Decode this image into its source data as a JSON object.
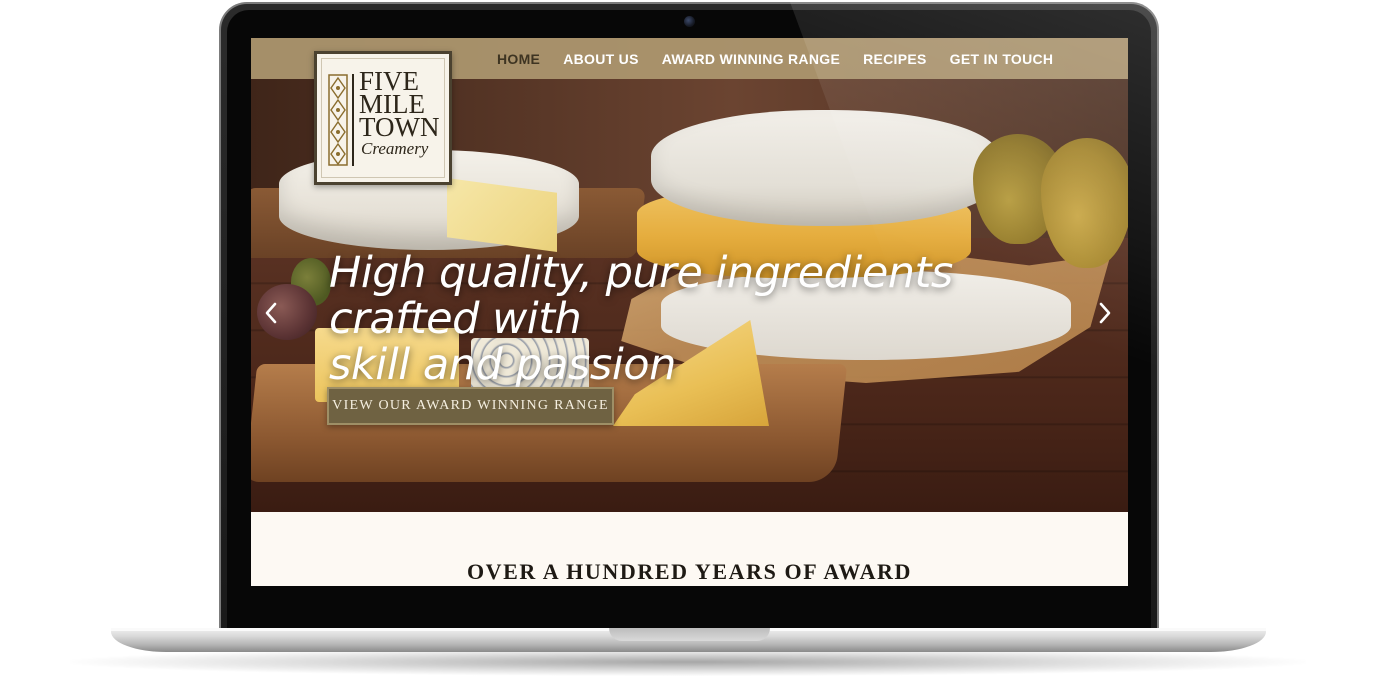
{
  "site": {
    "logo": {
      "lines": [
        "FIVE",
        "MILE",
        "TOWN"
      ],
      "sub": "Creamery"
    },
    "nav": {
      "items": [
        {
          "label": "HOME",
          "active": true
        },
        {
          "label": "ABOUT US",
          "active": false
        },
        {
          "label": "AWARD WINNING RANGE",
          "active": false
        },
        {
          "label": "RECIPES",
          "active": false
        },
        {
          "label": "GET IN TOUCH",
          "active": false
        }
      ]
    },
    "hero": {
      "headline_line1": "High quality, pure ingredients crafted with",
      "headline_line2": "skill and passion",
      "cta_label": "VIEW OUR AWARD WINNING RANGE",
      "prev_icon": "chevron-left-icon",
      "next_icon": "chevron-right-icon"
    },
    "intro": {
      "heading": "OVER A HUNDRED YEARS OF AWARD"
    }
  },
  "colors": {
    "nav_bg": "#ae9870",
    "nav_active": "#3e3422",
    "cta_bg": "#6f6242",
    "page_bg": "#fdf9f3",
    "heading": "#1e1a14"
  }
}
